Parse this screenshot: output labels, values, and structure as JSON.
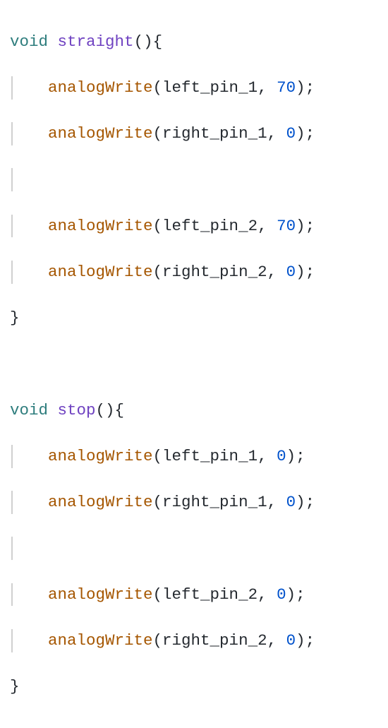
{
  "functions": [
    {
      "return_type": "void",
      "name": "straight",
      "body": [
        {
          "call": "analogWrite",
          "args": [
            "left_pin_1",
            "70"
          ]
        },
        {
          "call": "analogWrite",
          "args": [
            "right_pin_1",
            "0"
          ]
        },
        {
          "blank": true
        },
        {
          "call": "analogWrite",
          "args": [
            "left_pin_2",
            "70"
          ]
        },
        {
          "call": "analogWrite",
          "args": [
            "right_pin_2",
            "0"
          ]
        }
      ]
    },
    {
      "return_type": "void",
      "name": "stop",
      "body": [
        {
          "call": "analogWrite",
          "args": [
            "left_pin_1",
            "0"
          ]
        },
        {
          "call": "analogWrite",
          "args": [
            "right_pin_1",
            "0"
          ]
        },
        {
          "blank": true
        },
        {
          "call": "analogWrite",
          "args": [
            "left_pin_2",
            "0"
          ]
        },
        {
          "call": "analogWrite",
          "args": [
            "right_pin_2",
            "0"
          ]
        }
      ]
    }
  ]
}
